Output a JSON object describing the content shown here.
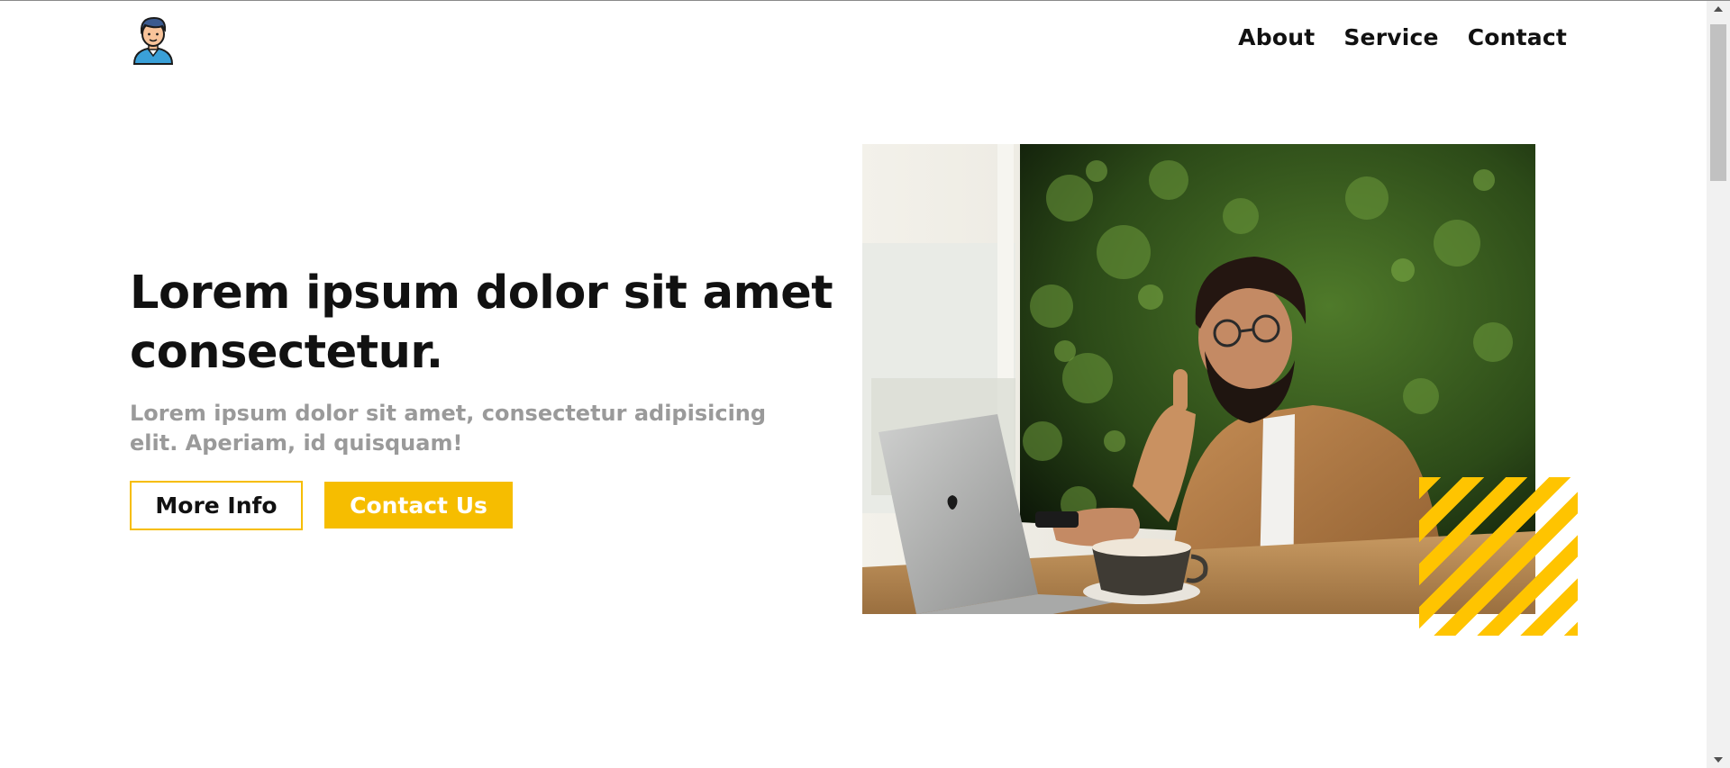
{
  "header": {
    "logo_icon": "person-avatar-icon",
    "nav": [
      {
        "label": "About"
      },
      {
        "label": "Service"
      },
      {
        "label": "Contact"
      }
    ]
  },
  "hero": {
    "title": "Lorem ipsum dolor sit amet consectetur.",
    "subtitle": "Lorem ipsum dolor sit amet, consectetur adipisicing elit. Aperiam, id quisquam!",
    "buttons": {
      "more_info": "More Info",
      "contact_us": "Contact Us"
    },
    "image_icon": "man-with-laptop-photo",
    "decoration_icon": "diagonal-stripes-icon"
  },
  "colors": {
    "accent": "#f6bd00",
    "text": "#111111",
    "muted": "#9a9a9a",
    "background": "#ffffff"
  }
}
